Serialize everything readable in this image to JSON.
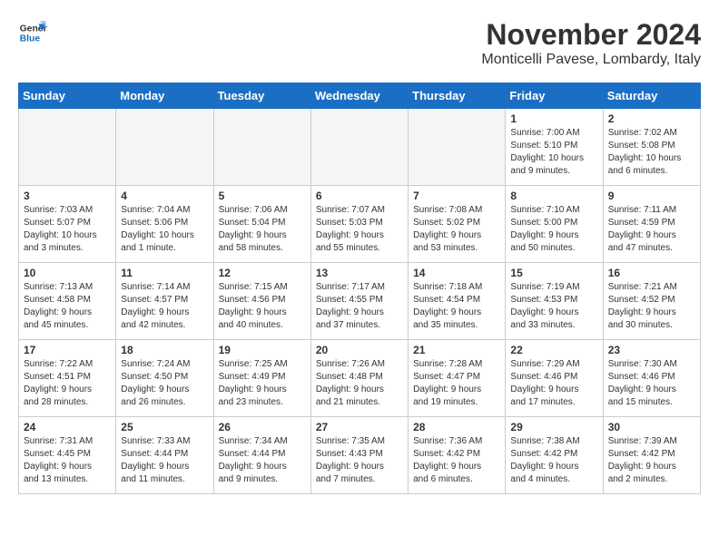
{
  "header": {
    "logo_line1": "General",
    "logo_line2": "Blue",
    "title": "November 2024",
    "location": "Monticelli Pavese, Lombardy, Italy"
  },
  "days_of_week": [
    "Sunday",
    "Monday",
    "Tuesday",
    "Wednesday",
    "Thursday",
    "Friday",
    "Saturday"
  ],
  "weeks": [
    [
      {
        "day": "",
        "info": ""
      },
      {
        "day": "",
        "info": ""
      },
      {
        "day": "",
        "info": ""
      },
      {
        "day": "",
        "info": ""
      },
      {
        "day": "",
        "info": ""
      },
      {
        "day": "1",
        "info": "Sunrise: 7:00 AM\nSunset: 5:10 PM\nDaylight: 10 hours\nand 9 minutes."
      },
      {
        "day": "2",
        "info": "Sunrise: 7:02 AM\nSunset: 5:08 PM\nDaylight: 10 hours\nand 6 minutes."
      }
    ],
    [
      {
        "day": "3",
        "info": "Sunrise: 7:03 AM\nSunset: 5:07 PM\nDaylight: 10 hours\nand 3 minutes."
      },
      {
        "day": "4",
        "info": "Sunrise: 7:04 AM\nSunset: 5:06 PM\nDaylight: 10 hours\nand 1 minute."
      },
      {
        "day": "5",
        "info": "Sunrise: 7:06 AM\nSunset: 5:04 PM\nDaylight: 9 hours\nand 58 minutes."
      },
      {
        "day": "6",
        "info": "Sunrise: 7:07 AM\nSunset: 5:03 PM\nDaylight: 9 hours\nand 55 minutes."
      },
      {
        "day": "7",
        "info": "Sunrise: 7:08 AM\nSunset: 5:02 PM\nDaylight: 9 hours\nand 53 minutes."
      },
      {
        "day": "8",
        "info": "Sunrise: 7:10 AM\nSunset: 5:00 PM\nDaylight: 9 hours\nand 50 minutes."
      },
      {
        "day": "9",
        "info": "Sunrise: 7:11 AM\nSunset: 4:59 PM\nDaylight: 9 hours\nand 47 minutes."
      }
    ],
    [
      {
        "day": "10",
        "info": "Sunrise: 7:13 AM\nSunset: 4:58 PM\nDaylight: 9 hours\nand 45 minutes."
      },
      {
        "day": "11",
        "info": "Sunrise: 7:14 AM\nSunset: 4:57 PM\nDaylight: 9 hours\nand 42 minutes."
      },
      {
        "day": "12",
        "info": "Sunrise: 7:15 AM\nSunset: 4:56 PM\nDaylight: 9 hours\nand 40 minutes."
      },
      {
        "day": "13",
        "info": "Sunrise: 7:17 AM\nSunset: 4:55 PM\nDaylight: 9 hours\nand 37 minutes."
      },
      {
        "day": "14",
        "info": "Sunrise: 7:18 AM\nSunset: 4:54 PM\nDaylight: 9 hours\nand 35 minutes."
      },
      {
        "day": "15",
        "info": "Sunrise: 7:19 AM\nSunset: 4:53 PM\nDaylight: 9 hours\nand 33 minutes."
      },
      {
        "day": "16",
        "info": "Sunrise: 7:21 AM\nSunset: 4:52 PM\nDaylight: 9 hours\nand 30 minutes."
      }
    ],
    [
      {
        "day": "17",
        "info": "Sunrise: 7:22 AM\nSunset: 4:51 PM\nDaylight: 9 hours\nand 28 minutes."
      },
      {
        "day": "18",
        "info": "Sunrise: 7:24 AM\nSunset: 4:50 PM\nDaylight: 9 hours\nand 26 minutes."
      },
      {
        "day": "19",
        "info": "Sunrise: 7:25 AM\nSunset: 4:49 PM\nDaylight: 9 hours\nand 23 minutes."
      },
      {
        "day": "20",
        "info": "Sunrise: 7:26 AM\nSunset: 4:48 PM\nDaylight: 9 hours\nand 21 minutes."
      },
      {
        "day": "21",
        "info": "Sunrise: 7:28 AM\nSunset: 4:47 PM\nDaylight: 9 hours\nand 19 minutes."
      },
      {
        "day": "22",
        "info": "Sunrise: 7:29 AM\nSunset: 4:46 PM\nDaylight: 9 hours\nand 17 minutes."
      },
      {
        "day": "23",
        "info": "Sunrise: 7:30 AM\nSunset: 4:46 PM\nDaylight: 9 hours\nand 15 minutes."
      }
    ],
    [
      {
        "day": "24",
        "info": "Sunrise: 7:31 AM\nSunset: 4:45 PM\nDaylight: 9 hours\nand 13 minutes."
      },
      {
        "day": "25",
        "info": "Sunrise: 7:33 AM\nSunset: 4:44 PM\nDaylight: 9 hours\nand 11 minutes."
      },
      {
        "day": "26",
        "info": "Sunrise: 7:34 AM\nSunset: 4:44 PM\nDaylight: 9 hours\nand 9 minutes."
      },
      {
        "day": "27",
        "info": "Sunrise: 7:35 AM\nSunset: 4:43 PM\nDaylight: 9 hours\nand 7 minutes."
      },
      {
        "day": "28",
        "info": "Sunrise: 7:36 AM\nSunset: 4:42 PM\nDaylight: 9 hours\nand 6 minutes."
      },
      {
        "day": "29",
        "info": "Sunrise: 7:38 AM\nSunset: 4:42 PM\nDaylight: 9 hours\nand 4 minutes."
      },
      {
        "day": "30",
        "info": "Sunrise: 7:39 AM\nSunset: 4:42 PM\nDaylight: 9 hours\nand 2 minutes."
      }
    ]
  ]
}
